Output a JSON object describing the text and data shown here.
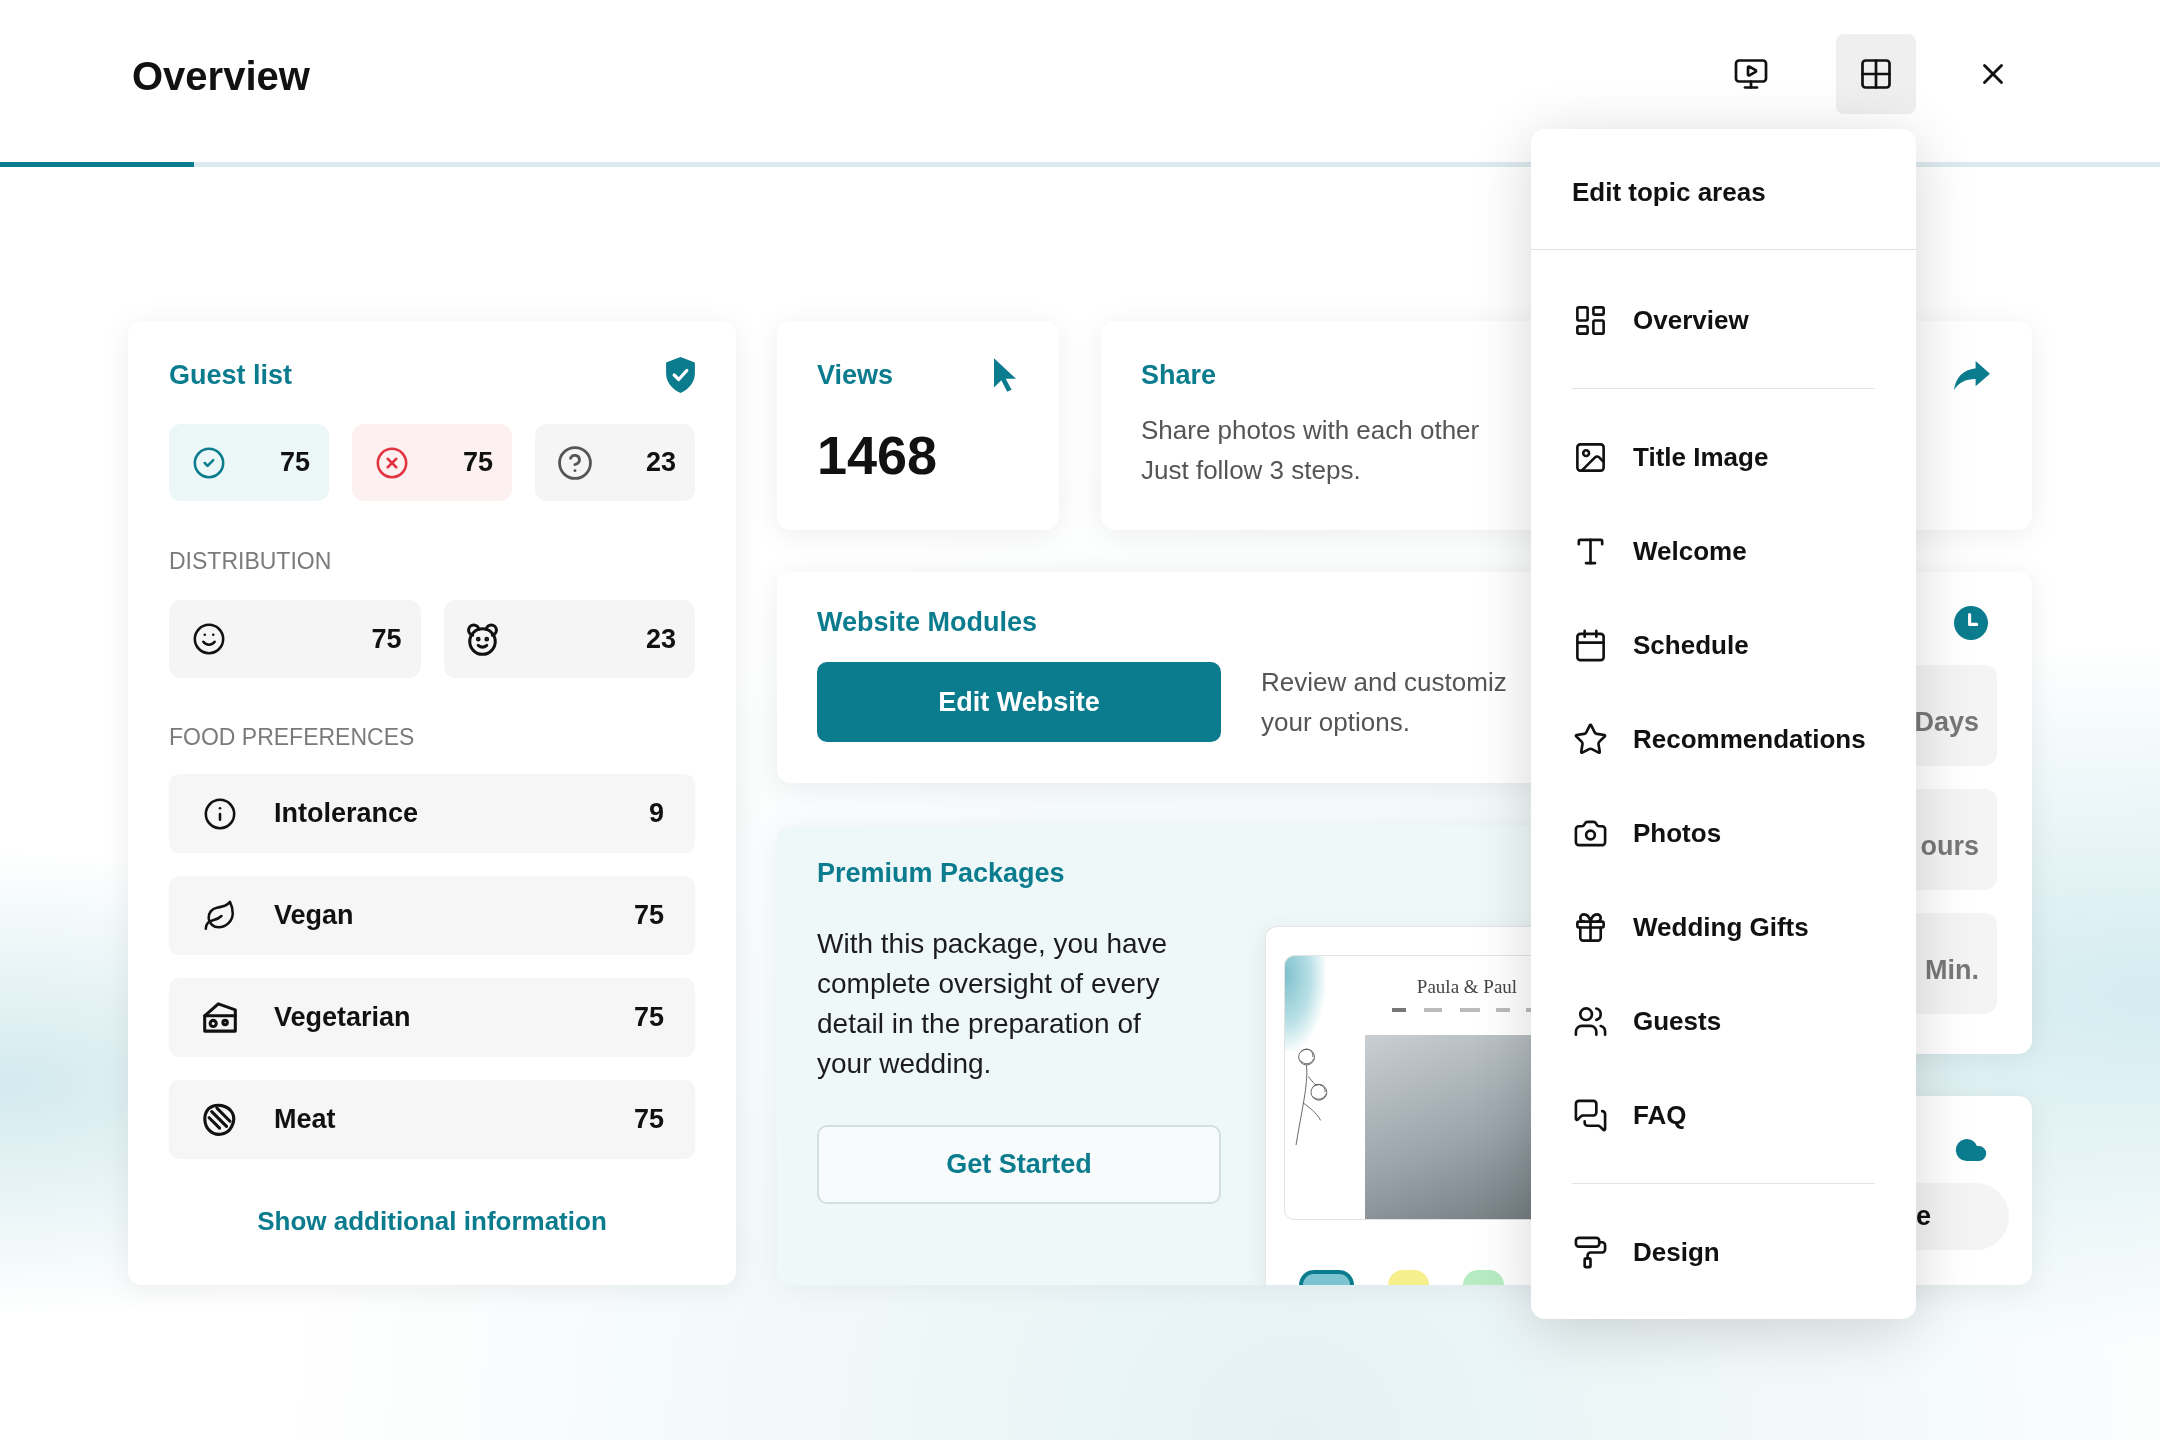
{
  "header": {
    "title": "Overview",
    "view_buttons": [
      {
        "selected": false
      },
      {
        "selected": true
      }
    ],
    "progress": {
      "level": 0.09
    }
  },
  "guest_list": {
    "title": "Guest list",
    "responses": [
      {
        "kind": "accepted",
        "count": "75"
      },
      {
        "kind": "declined",
        "count": "75"
      },
      {
        "kind": "pending",
        "count": "23"
      }
    ],
    "distribution_label": "DISTRIBUTION",
    "distribution": [
      {
        "count": "75"
      },
      {
        "count": "23"
      }
    ],
    "food_label": "FOOD PREFERENCES",
    "food_preferences": [
      {
        "label": "Intolerance",
        "count": "9"
      },
      {
        "label": "Vegan",
        "count": "75"
      },
      {
        "label": "Vegetarian",
        "count": "75"
      },
      {
        "label": "Meat",
        "count": "75"
      }
    ],
    "link": "Show additional information"
  },
  "views": {
    "title": "Views",
    "count": "1468"
  },
  "share": {
    "title": "Share",
    "lines": [
      "Share photos with each other",
      "Just follow 3 steps."
    ]
  },
  "website_modules": {
    "title": "Website Modules",
    "button": "Edit Website",
    "lines": [
      "Review and customiz",
      "your options."
    ]
  },
  "premium_packages": {
    "title": "Premium Packages",
    "text": "With this package, you have complete oversight of every detail in the preparation of your wedding.",
    "button": "Get Started",
    "preview": {
      "title": "Paula & Paul",
      "swatches": [
        {
          "color": "#7cc4d0",
          "selected": true
        },
        {
          "color": "#f6ef8c",
          "selected": false
        },
        {
          "color": "#b7ecc2",
          "selected": false
        }
      ]
    }
  },
  "countdown": {
    "units": [
      "Days",
      "ours",
      "Min."
    ]
  },
  "upload_card": {
    "button": "e"
  },
  "menu": {
    "title": "Edit topic areas",
    "groups": [
      [
        {
          "label": "Overview"
        }
      ],
      [
        {
          "label": "Title Image"
        },
        {
          "label": "Welcome"
        },
        {
          "label": "Schedule"
        },
        {
          "label": "Recommendations"
        },
        {
          "label": "Photos"
        },
        {
          "label": "Wedding Gifts"
        },
        {
          "label": "Guests"
        },
        {
          "label": "FAQ"
        }
      ],
      [
        {
          "label": "Design"
        }
      ]
    ]
  }
}
